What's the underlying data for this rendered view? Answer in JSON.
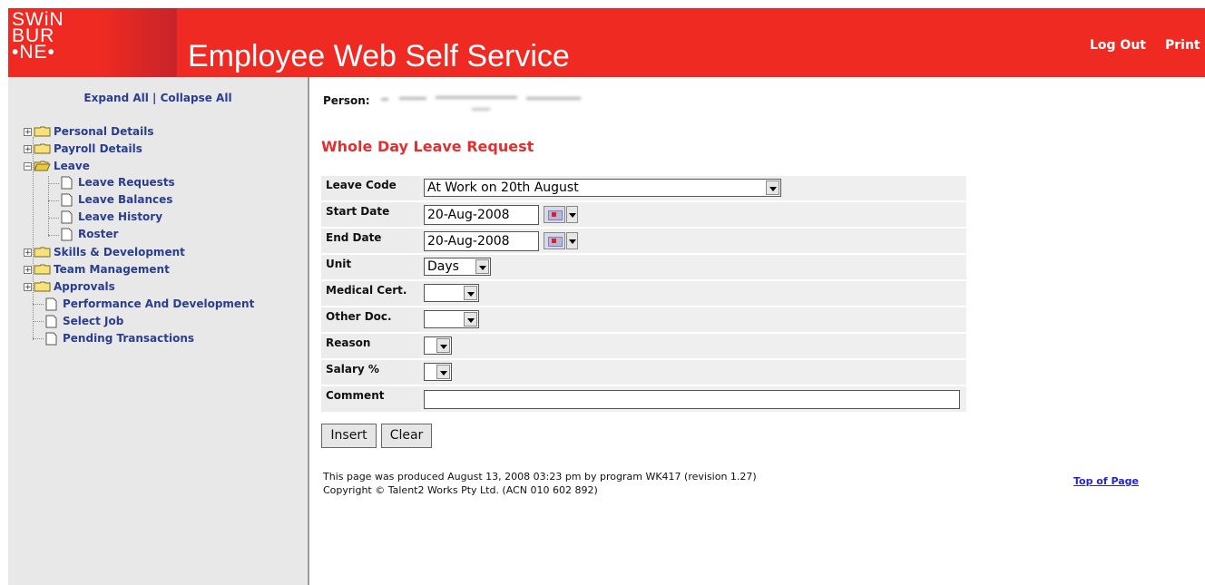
{
  "header": {
    "logo_text": "SWiN\nBUR\n•NE•",
    "title": "Employee Web Self Service",
    "logout": "Log Out",
    "print": "Print",
    "background_color": "#ee2a22"
  },
  "sidebar": {
    "expand_all": "Expand All",
    "separator": " | ",
    "collapse_all": "Collapse All",
    "items": [
      {
        "label": "Personal Details",
        "type": "folder",
        "expanded": false
      },
      {
        "label": "Payroll Details",
        "type": "folder",
        "expanded": false
      },
      {
        "label": "Leave",
        "type": "folder",
        "expanded": true
      },
      {
        "label": "Leave Requests",
        "type": "page",
        "level": 2
      },
      {
        "label": "Leave Balances",
        "type": "page",
        "level": 2
      },
      {
        "label": "Leave History",
        "type": "page",
        "level": 2
      },
      {
        "label": "Roster",
        "type": "page",
        "level": 2
      },
      {
        "label": "Skills & Development",
        "type": "folder",
        "expanded": false
      },
      {
        "label": "Team Management",
        "type": "folder",
        "expanded": false
      },
      {
        "label": "Approvals",
        "type": "folder",
        "expanded": false
      },
      {
        "label": "Performance And Development",
        "type": "page"
      },
      {
        "label": "Select Job",
        "type": "page"
      },
      {
        "label": "Pending Transactions",
        "type": "page"
      }
    ]
  },
  "main": {
    "person_label": "Person:",
    "page_title": "Whole Day Leave Request",
    "title_color": "#e03030",
    "form": {
      "leave_code": {
        "label": "Leave Code",
        "value": "At Work on 20th August"
      },
      "start_date": {
        "label": "Start Date",
        "value": "20-Aug-2008"
      },
      "end_date": {
        "label": "End Date",
        "value": "20-Aug-2008"
      },
      "unit": {
        "label": "Unit",
        "value": "Days"
      },
      "medical_cert": {
        "label": "Medical Cert.",
        "value": ""
      },
      "other_doc": {
        "label": "Other Doc.",
        "value": ""
      },
      "reason": {
        "label": "Reason",
        "value": ""
      },
      "salary": {
        "label": "Salary %",
        "value": ""
      },
      "comment": {
        "label": "Comment",
        "value": ""
      }
    },
    "buttons": {
      "insert": "Insert",
      "clear": "Clear"
    },
    "footer_line1": "This page was produced August 13, 2008 03:23 pm by program WK417 (revision 1.27)",
    "footer_line2": "Copyright © Talent2 Works Pty Ltd. (ACN 010 602 892)",
    "top_of_page": "Top of Page"
  }
}
